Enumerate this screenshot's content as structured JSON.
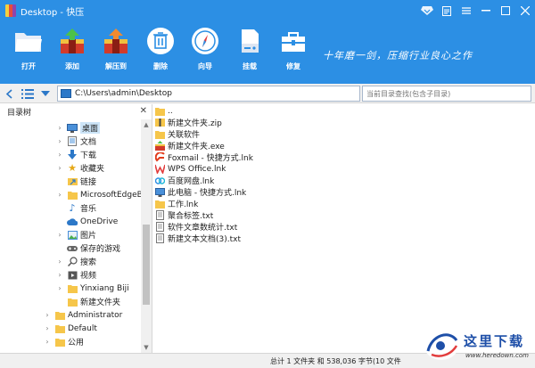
{
  "window": {
    "title": "Desktop - 快压"
  },
  "toolbar": {
    "buttons": [
      {
        "label": "打开",
        "icon": "open-folder-icon"
      },
      {
        "label": "添加",
        "icon": "add-archive-icon"
      },
      {
        "label": "解压到",
        "icon": "extract-icon"
      },
      {
        "label": "删除",
        "icon": "delete-icon"
      },
      {
        "label": "向导",
        "icon": "compass-icon"
      },
      {
        "label": "挂载",
        "icon": "mount-drive-icon"
      },
      {
        "label": "修复",
        "icon": "repair-toolbox-icon"
      }
    ],
    "slogan": "十年磨一剑，压缩行业良心之作"
  },
  "navbar": {
    "path": "C:\\Users\\admin\\Desktop",
    "search_placeholder": "当前目录查找(包含子目录)"
  },
  "sidebar": {
    "title": "目录树",
    "items": [
      {
        "label": "桌面",
        "icon": "desktop-icon",
        "selected": true
      },
      {
        "label": "文档",
        "icon": "documents-icon"
      },
      {
        "label": "下载",
        "icon": "download-icon"
      },
      {
        "label": "收藏夹",
        "icon": "star-icon"
      },
      {
        "label": "链接",
        "icon": "link-icon"
      },
      {
        "label": "MicrosoftEdgeB",
        "icon": "folder-icon"
      },
      {
        "label": "音乐",
        "icon": "music-icon"
      },
      {
        "label": "OneDrive",
        "icon": "cloud-icon"
      },
      {
        "label": "图片",
        "icon": "pictures-icon"
      },
      {
        "label": "保存的游戏",
        "icon": "saved-games-icon"
      },
      {
        "label": "搜索",
        "icon": "search-icon"
      },
      {
        "label": "视频",
        "icon": "video-icon"
      },
      {
        "label": "Yinxiang Biji",
        "icon": "folder-icon"
      },
      {
        "label": "新建文件夹",
        "icon": "folder-icon"
      },
      {
        "label": "Administrator",
        "icon": "folder-icon"
      },
      {
        "label": "Default",
        "icon": "folder-icon"
      },
      {
        "label": "公用",
        "icon": "folder-icon"
      }
    ]
  },
  "files": [
    {
      "name": "..",
      "icon": "folder-icon"
    },
    {
      "name": "新建文件夹.zip",
      "icon": "zip-icon"
    },
    {
      "name": "关联软件",
      "icon": "folder-icon"
    },
    {
      "name": "新建文件夹.exe",
      "icon": "exe-archive-icon"
    },
    {
      "name": "Foxmail - 快捷方式.lnk",
      "icon": "foxmail-icon"
    },
    {
      "name": "WPS Office.lnk",
      "icon": "wps-icon"
    },
    {
      "name": "百度网盘.lnk",
      "icon": "baidu-netdisk-icon"
    },
    {
      "name": "此电脑 - 快捷方式.lnk",
      "icon": "computer-icon"
    },
    {
      "name": "工作.lnk",
      "icon": "folder-icon"
    },
    {
      "name": "聚合标签.txt",
      "icon": "text-file-icon"
    },
    {
      "name": "软件文章数统计.txt",
      "icon": "text-file-icon"
    },
    {
      "name": "新建文本文档(3).txt",
      "icon": "text-file-icon"
    }
  ],
  "status": {
    "text": "总计 1 文件夹 和 538,036 字节(10 文件"
  },
  "watermark": {
    "text": "这里下载",
    "url": "www.heredown.com"
  },
  "colors": {
    "accent": "#2c8fe4",
    "folder": "#f6c64a",
    "selection": "#cce4f7"
  }
}
